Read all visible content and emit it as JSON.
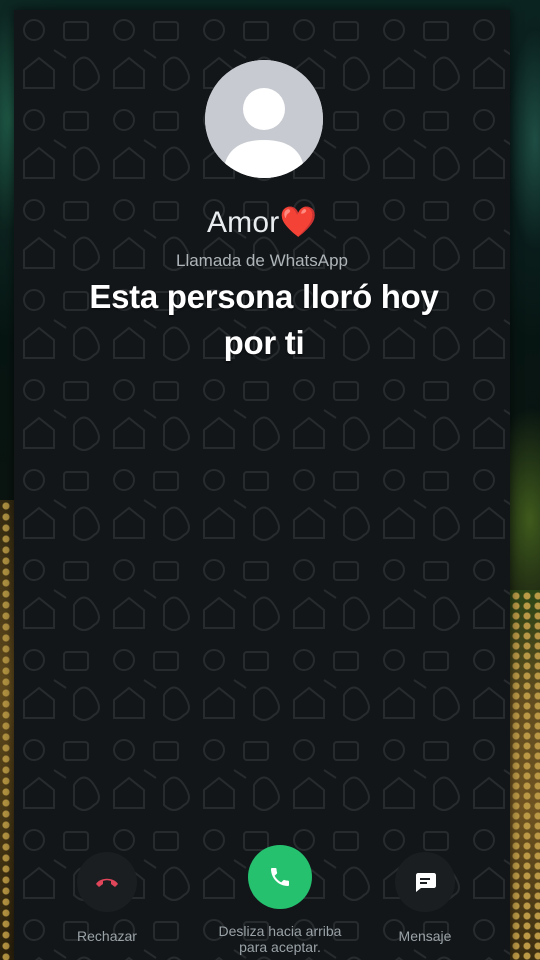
{
  "contact": {
    "name": "Amor",
    "emoji": "❤️",
    "call_type": "Llamada de WhatsApp"
  },
  "overlay": {
    "line1": "Esta persona lloró hoy",
    "line2": "por ti"
  },
  "actions": {
    "reject_label": "Rechazar",
    "accept_label_line1": "Desliza hacia arriba",
    "accept_label_line2": "para aceptar.",
    "message_label": "Mensaje"
  },
  "icons": {
    "avatar": "default-person-avatar",
    "reject": "phone-hangup-icon",
    "accept": "phone-icon",
    "message": "message-icon"
  },
  "colors": {
    "accept": "#25c16f",
    "reject_icon": "#e0455a",
    "background": "#121619"
  }
}
